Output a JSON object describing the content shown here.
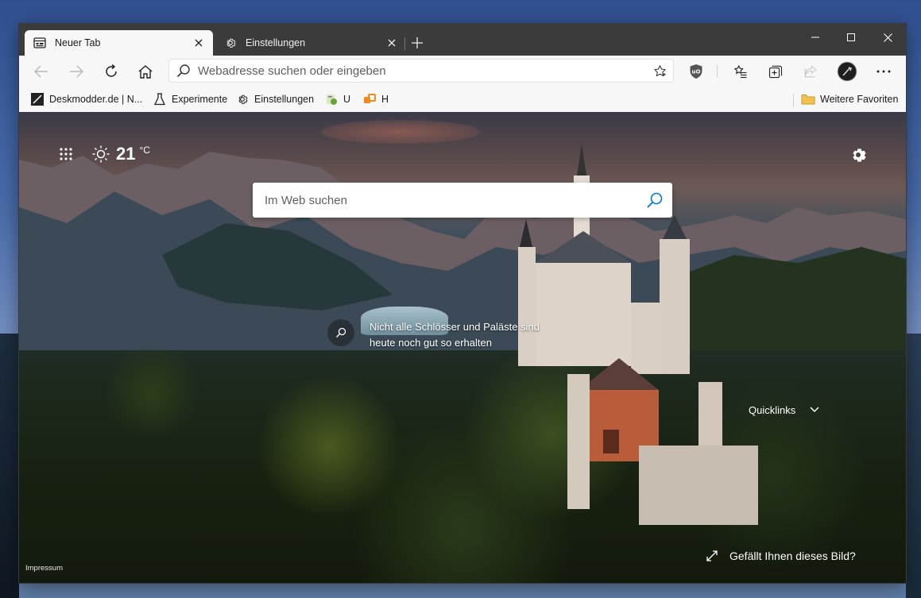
{
  "tabs": [
    {
      "title": "Neuer Tab",
      "icon": "newtab-page-icon",
      "active": true
    },
    {
      "title": "Einstellungen",
      "icon": "gear-icon",
      "active": false
    }
  ],
  "address_bar": {
    "placeholder": "Webadresse suchen oder eingeben"
  },
  "favorites": [
    {
      "label": "Deskmodder.de | N...",
      "icon": "deskmodder-icon"
    },
    {
      "label": "Experimente",
      "icon": "flask-icon"
    },
    {
      "label": "Einstellungen",
      "icon": "gear-icon"
    },
    {
      "label": "U",
      "icon": "extension-icon"
    },
    {
      "label": "H",
      "icon": "h-app-icon"
    }
  ],
  "other_favorites": "Weitere Favoriten",
  "newtab": {
    "weather": {
      "temp": "21",
      "unit": "°C",
      "icon": "sun-icon"
    },
    "search_placeholder": "Im Web suchen",
    "image_caption": "Nicht alle Schlösser und Paläste sind heute noch gut so erhalten",
    "quicklinks": "Quicklinks",
    "like_image": "Gefällt Ihnen dieses Bild?",
    "impressum": "Impressum"
  },
  "colors": {
    "tabstrip": "#3b3b3b",
    "toolbar": "#f7f7f7",
    "accent": "#0078d4"
  }
}
